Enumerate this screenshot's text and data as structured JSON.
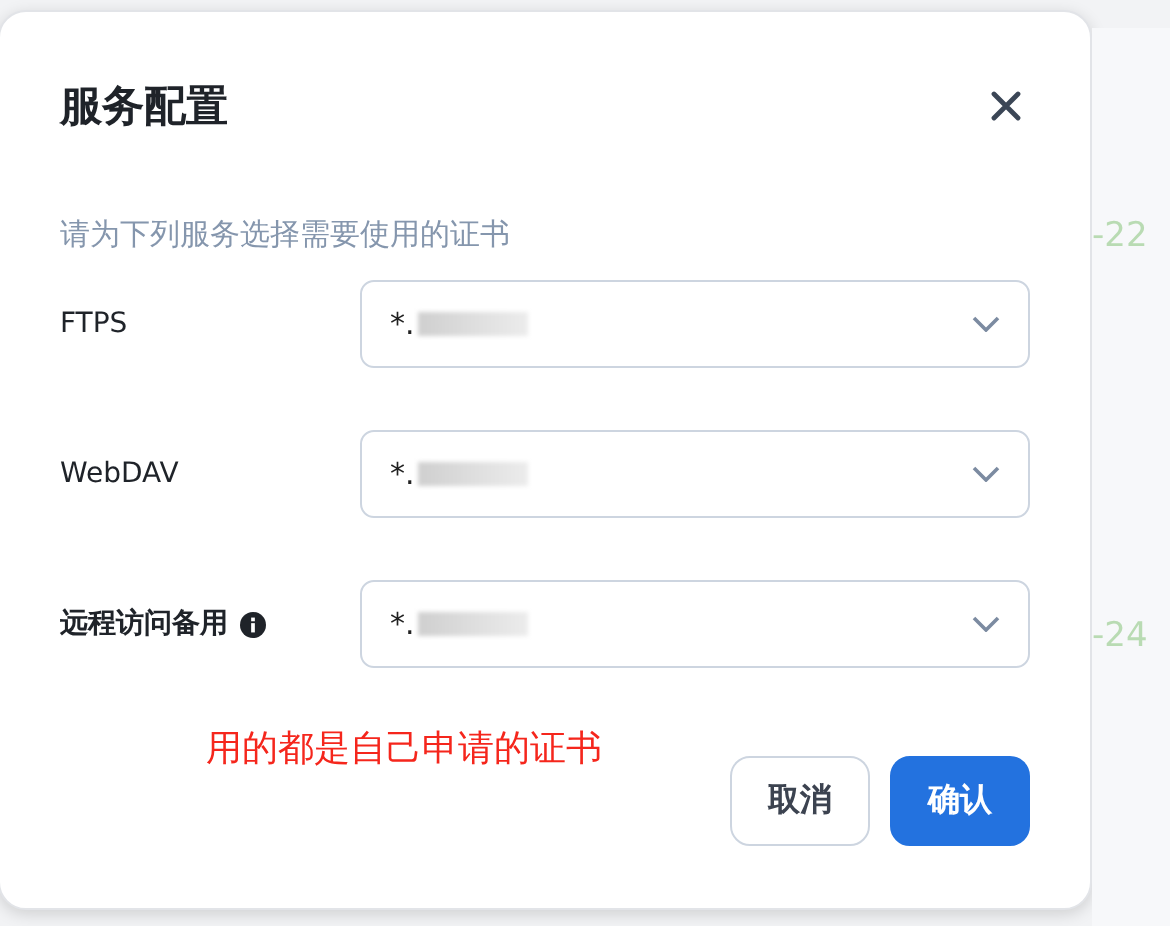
{
  "background": {
    "texts": [
      "-22",
      "-24"
    ]
  },
  "dialog": {
    "title": "服务配置",
    "subtitle": "请为下列服务选择需要使用的证书",
    "fields": [
      {
        "label": "FTPS",
        "value": "*.",
        "info": false,
        "redacted": true
      },
      {
        "label": "WebDAV",
        "value": "*.",
        "info": false,
        "redacted": true
      },
      {
        "label": "远程访问备用",
        "value": "*.",
        "info": true,
        "redacted": true
      }
    ],
    "note": "用的都是自己申请的证书",
    "buttons": [
      {
        "label": "取消",
        "kind": "secondary"
      },
      {
        "label": "确认",
        "kind": "primary"
      }
    ]
  }
}
